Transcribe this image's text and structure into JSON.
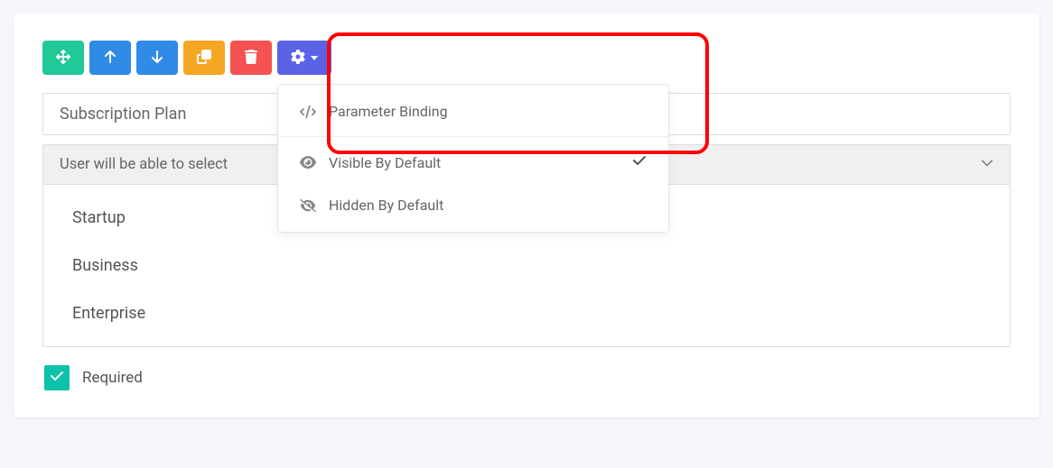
{
  "colors": {
    "teal": "#20c997",
    "blue": "#2f8be6",
    "orange": "#f5a623",
    "red": "#f55252",
    "purple": "#5a63e6",
    "checkbox": "#0cc2aa"
  },
  "dropdown": {
    "items": [
      {
        "label": "Parameter Binding",
        "icon": "code"
      },
      {
        "label": "Visible By Default",
        "icon": "eye",
        "checked": true
      },
      {
        "label": "Hidden By Default",
        "icon": "eye-slash"
      }
    ]
  },
  "field": {
    "title": "Subscription Plan",
    "select_label": "User will be able to select",
    "options": [
      "Startup",
      "Business",
      "Enterprise"
    ]
  },
  "required": {
    "checked": true,
    "label": "Required"
  }
}
